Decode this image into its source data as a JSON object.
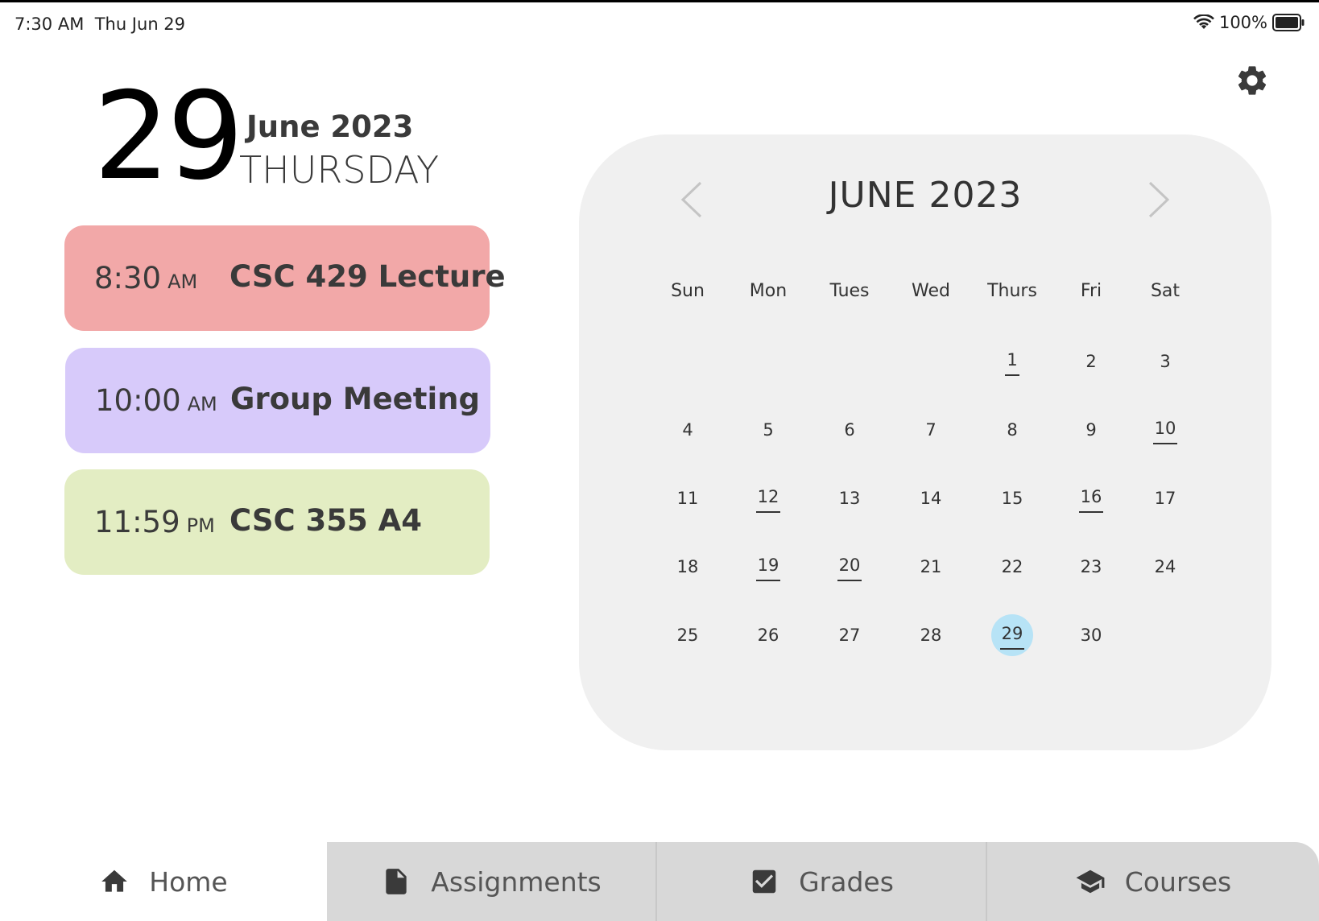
{
  "status_bar": {
    "time": "7:30 AM",
    "date": "Thu Jun 29",
    "battery": "100%"
  },
  "header": {
    "day_number": "29",
    "month_year": "June 2023",
    "weekday": "THURSDAY"
  },
  "events": [
    {
      "time": "8:30",
      "ampm": "AM",
      "title": "CSC 429 Lecture",
      "color": "#f2a8a8"
    },
    {
      "time": "10:00",
      "ampm": "AM",
      "title": "Group Meeting",
      "color": "#d7cafa"
    },
    {
      "time": "11:59",
      "ampm": "PM",
      "title": "CSC 355 A4",
      "color": "#e3edc3"
    }
  ],
  "calendar": {
    "title": "JUNE 2023",
    "weekdays": [
      "Sun",
      "Mon",
      "Tues",
      "Wed",
      "Thurs",
      "Fri",
      "Sat"
    ],
    "first_weekday_index": 4,
    "days_in_month": 30,
    "event_days": [
      1,
      10,
      12,
      16,
      19,
      20,
      29
    ],
    "today": 29,
    "today_color": "#b7e3f6"
  },
  "tabs": {
    "home": "Home",
    "assignments": "Assignments",
    "grades": "Grades",
    "courses": "Courses"
  },
  "icons": {
    "settings": "gear-icon",
    "home": "house-icon",
    "assignments": "document-icon",
    "grades": "checkbox-icon",
    "courses": "graduation-cap-icon"
  }
}
